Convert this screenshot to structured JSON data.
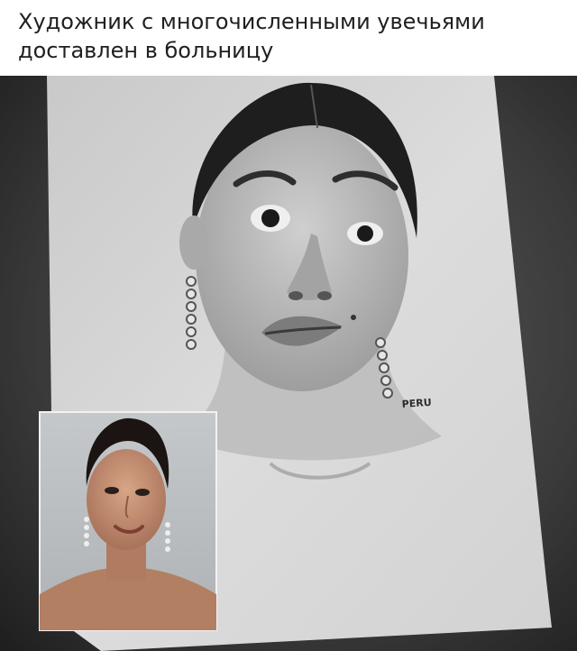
{
  "caption": {
    "line1": "Художник с многочисленными увечьями",
    "line2": "доставлен в больницу"
  },
  "drawing": {
    "signature": "PERU"
  }
}
